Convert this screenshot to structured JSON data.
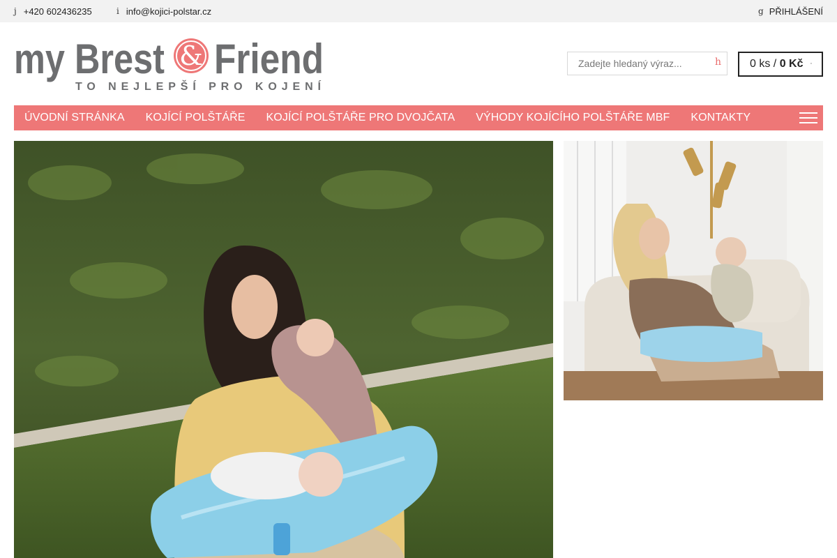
{
  "topbar": {
    "phone_glyph": "j",
    "phone": "+420 602436235",
    "email_glyph": "i",
    "email": "info@kojici-polstar.cz",
    "login_glyph": "g",
    "login": "PŘIHLÁŠENÍ"
  },
  "logo": {
    "word1": "my Brest",
    "word2": "Friend",
    "tagline": "TO NEJLEPŠÍ PRO KOJENÍ"
  },
  "search": {
    "placeholder": "Zadejte hledaný výraz...",
    "button_glyph": "h"
  },
  "cart": {
    "count": "0 ks",
    "separator": " / ",
    "total": "0 Kč",
    "arrow_glyph": "◦"
  },
  "nav": {
    "items": [
      "ÚVODNÍ STRÁNKA",
      "KOJÍCÍ POLŠTÁŘE",
      "KOJÍCÍ POLŠTÁŘE PRO DVOJČATA",
      "VÝHODY KOJÍCÍHO POLŠTÁŘE MBF",
      "KONTAKTY"
    ]
  },
  "colors": {
    "accent": "#ee7777",
    "logo_gray": "#6d6e70",
    "pillow_blue": "#8ccfe8",
    "topbar_bg": "#f2f2f2"
  },
  "icons": {
    "menu": "hamburger-icon",
    "search": "search-icon",
    "cart": "cart-icon",
    "user": "user-icon",
    "phone": "phone-icon",
    "email": "email-icon"
  }
}
